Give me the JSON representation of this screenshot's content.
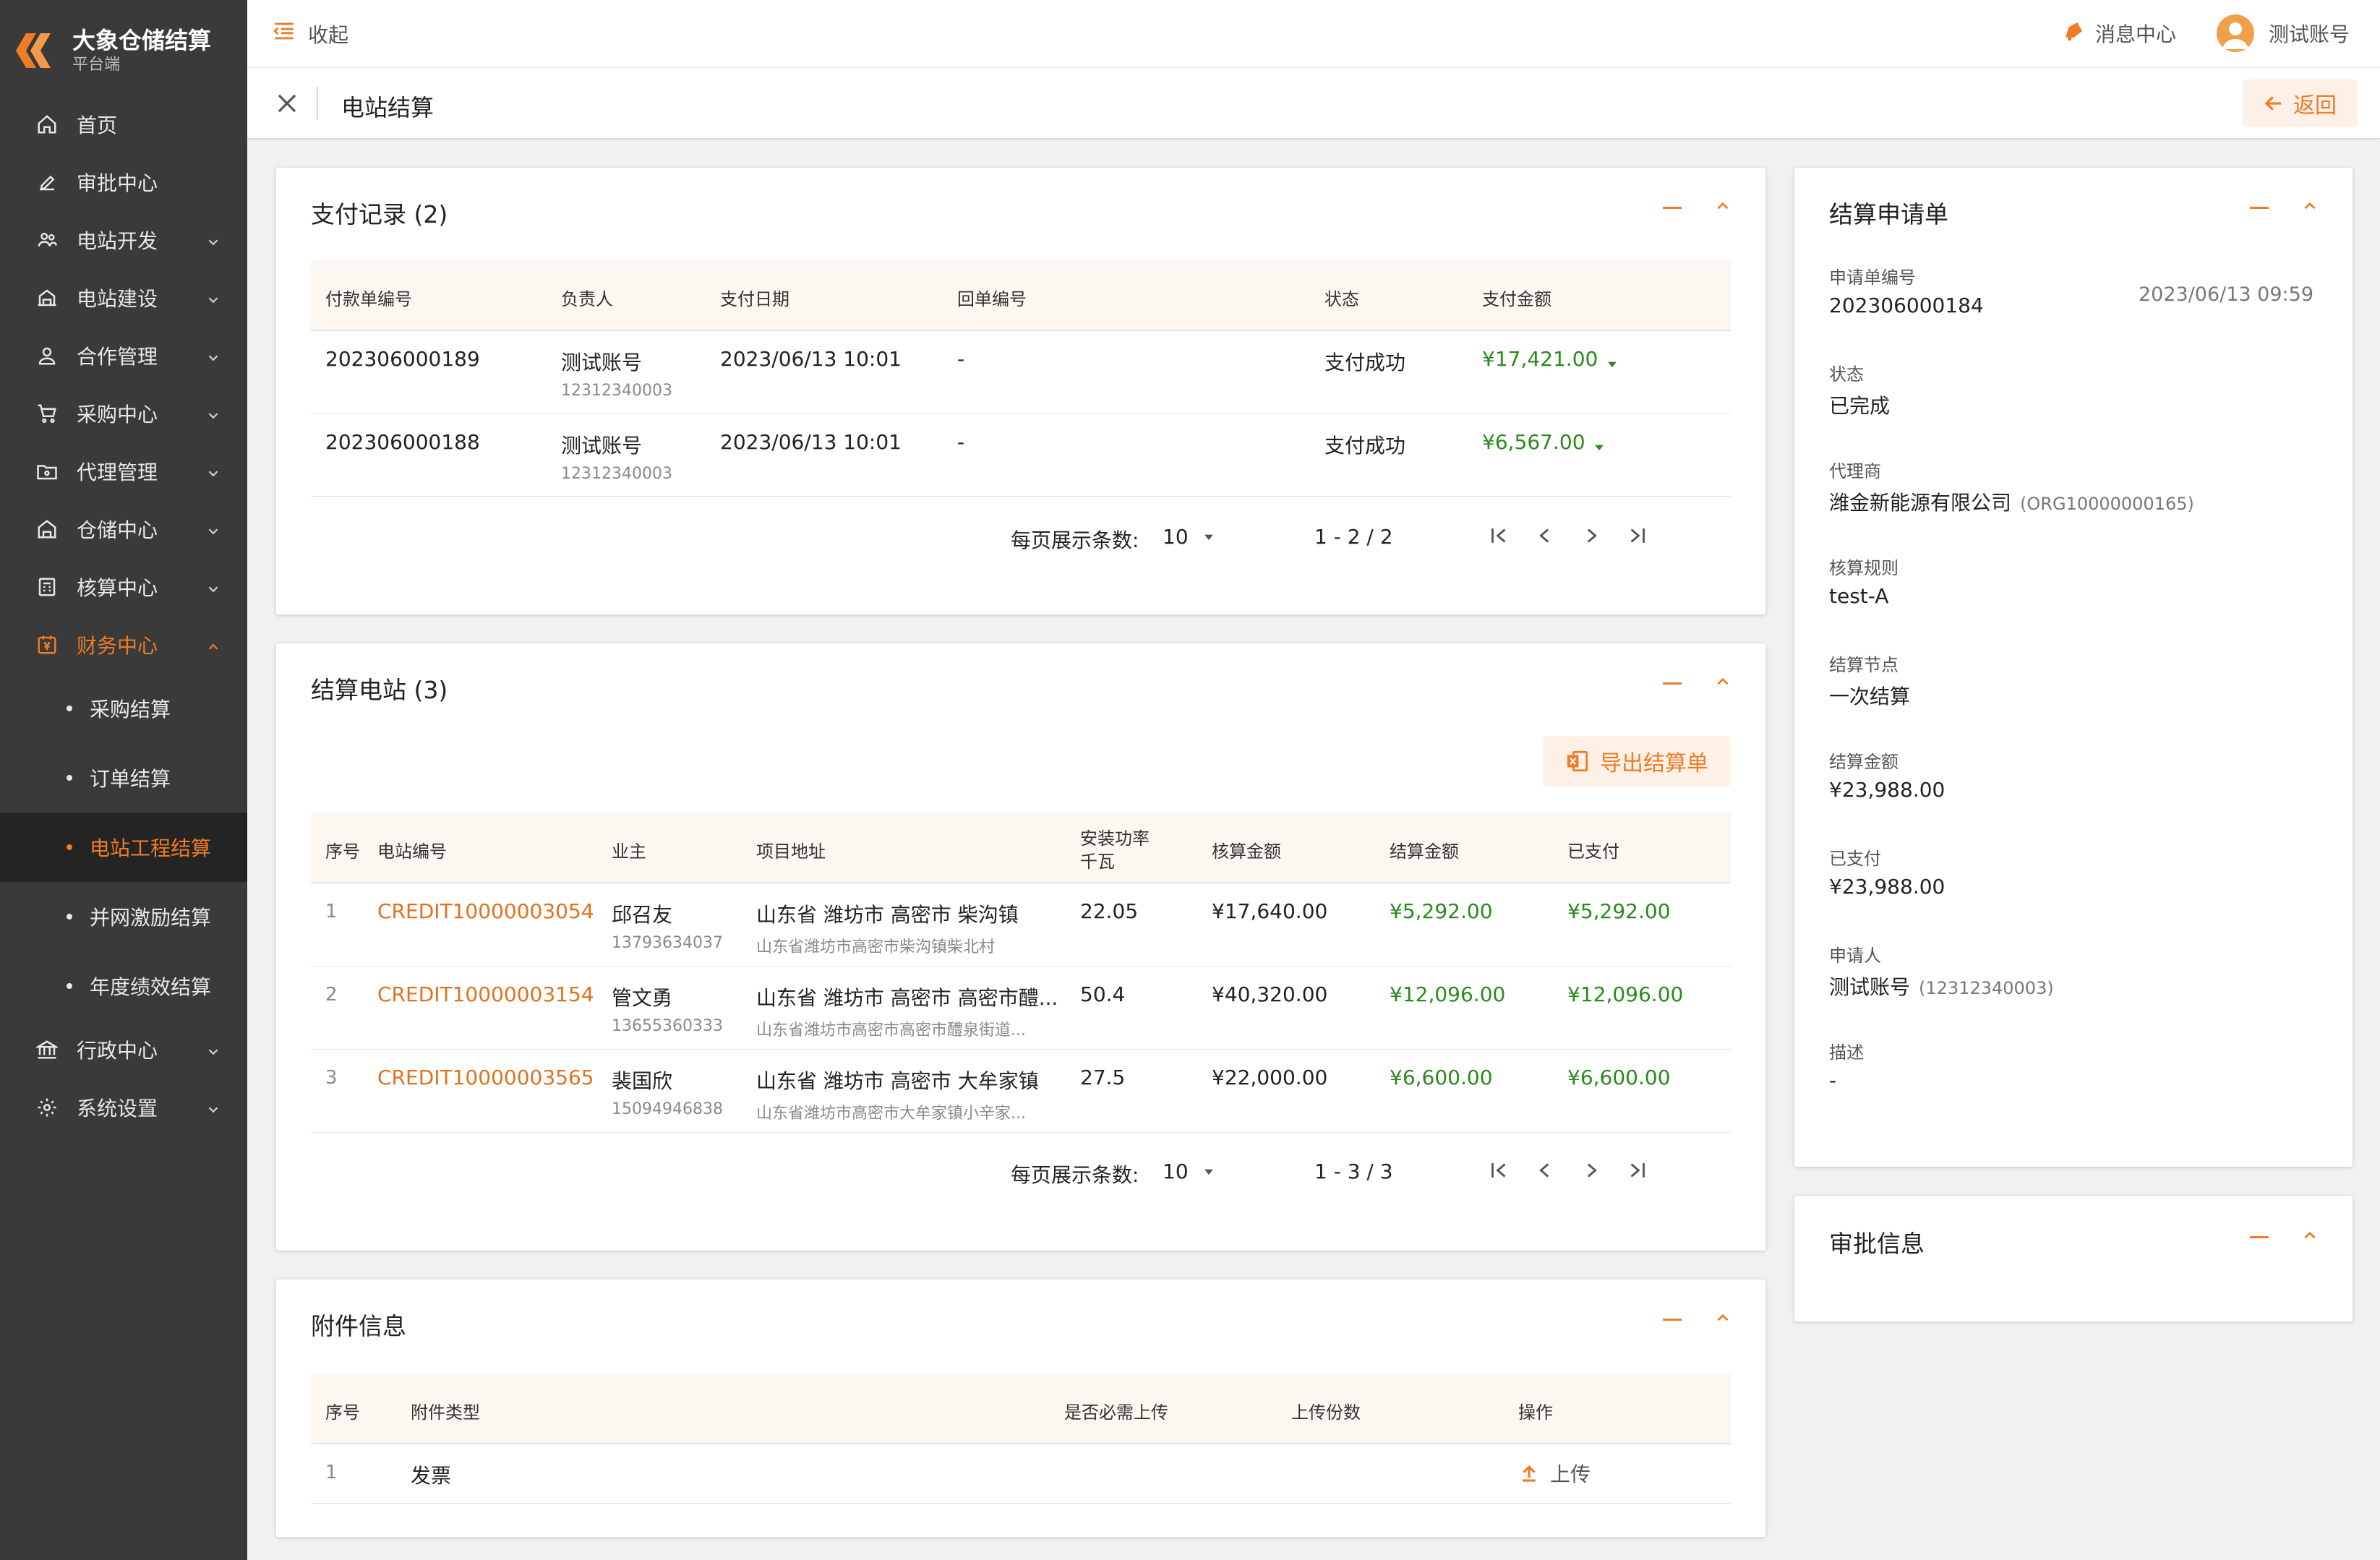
{
  "app": {
    "name": "大象仓储结算",
    "subtitle": "平台端"
  },
  "topbar": {
    "collapse_label": "收起",
    "messages_label": "消息中心",
    "user_label": "测试账号"
  },
  "titlebar": {
    "title": "电站结算",
    "back_label": "返回"
  },
  "sidebar": {
    "items": [
      {
        "label": "首页",
        "icon": "home-icon"
      },
      {
        "label": "审批中心",
        "icon": "pen-icon"
      },
      {
        "label": "电站开发",
        "icon": "people-icon"
      },
      {
        "label": "电站建设",
        "icon": "building-icon"
      },
      {
        "label": "合作管理",
        "icon": "person-icon"
      },
      {
        "label": "采购中心",
        "icon": "cart-icon"
      },
      {
        "label": "代理管理",
        "icon": "folder-icon"
      },
      {
        "label": "仓储中心",
        "icon": "warehouse-icon"
      },
      {
        "label": "核算中心",
        "icon": "calc-icon"
      },
      {
        "label": "财务中心",
        "icon": "finance-icon"
      }
    ],
    "sub_items": [
      "采购结算",
      "订单结算",
      "电站工程结算",
      "并网激励结算",
      "年度绩效结算"
    ],
    "bottom_items": [
      {
        "label": "行政中心",
        "icon": "bank-icon"
      },
      {
        "label": "系统设置",
        "icon": "gear-icon"
      }
    ]
  },
  "payments": {
    "title": "支付记录 (2)",
    "headers": [
      "付款单编号",
      "负责人",
      "支付日期",
      "回单编号",
      "状态",
      "支付金额"
    ],
    "rows": [
      {
        "no": "202306000189",
        "owner": "测试账号",
        "owner_id": "12312340003",
        "date": "2023/06/13 10:01",
        "receipt": "-",
        "status": "支付成功",
        "amount": "¥17,421.00"
      },
      {
        "no": "202306000188",
        "owner": "测试账号",
        "owner_id": "12312340003",
        "date": "2023/06/13 10:01",
        "receipt": "-",
        "status": "支付成功",
        "amount": "¥6,567.00"
      }
    ],
    "per_page_label": "每页展示条数:",
    "per_page": "10",
    "range": "1 - 2 / 2"
  },
  "stations": {
    "title": "结算电站 (3)",
    "export_label": "导出结算单",
    "headers": [
      "序号",
      "电站编号",
      "业主",
      "项目地址",
      "安装功率",
      "千瓦",
      "核算金额",
      "结算金额",
      "已支付"
    ],
    "rows": [
      {
        "idx": "1",
        "code": "CREDIT10000003054",
        "owner": "邱召友",
        "phone": "13793634037",
        "addr": "山东省 潍坊市 高密市 柴沟镇",
        "addr_detail": "山东省潍坊市高密市柴沟镇柴北村",
        "power": "22.05",
        "calc": "¥17,640.00",
        "settle": "¥5,292.00",
        "paid": "¥5,292.00"
      },
      {
        "idx": "2",
        "code": "CREDIT10000003154",
        "owner": "管文勇",
        "phone": "13655360333",
        "addr": "山东省 潍坊市 高密市 高密市醴...",
        "addr_detail": "山东省潍坊市高密市高密市醴泉街道...",
        "power": "50.4",
        "calc": "¥40,320.00",
        "settle": "¥12,096.00",
        "paid": "¥12,096.00"
      },
      {
        "idx": "3",
        "code": "CREDIT10000003565",
        "owner": "裴国欣",
        "phone": "15094946838",
        "addr": "山东省 潍坊市 高密市 大牟家镇",
        "addr_detail": "山东省潍坊市高密市大牟家镇小辛家...",
        "power": "27.5",
        "calc": "¥22,000.00",
        "settle": "¥6,600.00",
        "paid": "¥6,600.00"
      }
    ],
    "per_page_label": "每页展示条数:",
    "per_page": "10",
    "range": "1 - 3 / 3"
  },
  "attachments": {
    "title": "附件信息",
    "headers": [
      "序号",
      "附件类型",
      "是否必需上传",
      "上传份数",
      "操作"
    ],
    "rows": [
      {
        "idx": "1",
        "type": "发票",
        "required": "",
        "count": "",
        "action": "上传"
      }
    ]
  },
  "request": {
    "title": "结算申请单",
    "no_label": "申请单编号",
    "no": "202306000184",
    "time": "2023/06/13 09:59",
    "status_label": "状态",
    "status": "已完成",
    "agent_label": "代理商",
    "agent": "潍金新能源有限公司",
    "agent_code": "(ORG10000000165)",
    "rule_label": "核算规则",
    "rule": "test-A",
    "node_label": "结算节点",
    "node": "一次结算",
    "amount_label": "结算金额",
    "amount": "¥23,988.00",
    "paid_label": "已支付",
    "paid": "¥23,988.00",
    "applicant_label": "申请人",
    "applicant": "测试账号",
    "applicant_id": "(12312340003)",
    "desc_label": "描述",
    "desc": "-"
  },
  "approval": {
    "title": "审批信息"
  },
  "colors": {
    "accent": "#ee7b26",
    "green": "#2a8a1e",
    "sidebar": "#3a3a3a"
  }
}
